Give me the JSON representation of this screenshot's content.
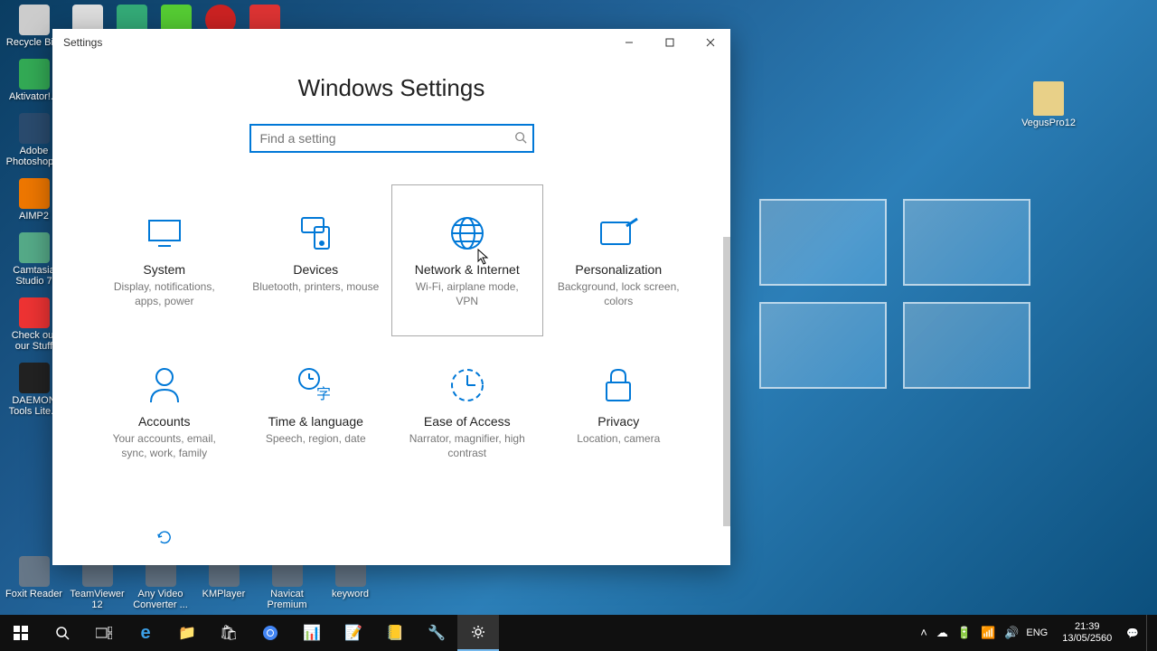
{
  "window": {
    "title": "Settings",
    "page_title": "Windows Settings",
    "search_placeholder": "Find a setting"
  },
  "categories": [
    {
      "name": "System",
      "desc": "Display, notifications, apps, power",
      "hover": false
    },
    {
      "name": "Devices",
      "desc": "Bluetooth, printers, mouse",
      "hover": false
    },
    {
      "name": "Network & Internet",
      "desc": "Wi-Fi, airplane mode, VPN",
      "hover": true
    },
    {
      "name": "Personalization",
      "desc": "Background, lock screen, colors",
      "hover": false
    },
    {
      "name": "Accounts",
      "desc": "Your accounts, email, sync, work, family",
      "hover": false
    },
    {
      "name": "Time & language",
      "desc": "Speech, region, date",
      "hover": false
    },
    {
      "name": "Ease of Access",
      "desc": "Narrator, magnifier, high contrast",
      "hover": false
    },
    {
      "name": "Privacy",
      "desc": "Location, camera",
      "hover": false
    }
  ],
  "desktop_icons_left": [
    "Recycle Bi...",
    "Aktivator!...",
    "Adobe Photoshop...",
    "AIMP2",
    "Camtasia Studio 7",
    "Check out our Stuff",
    "DAEMON Tools Lite..."
  ],
  "desktop_icons_bottom": [
    "Foxit Reader",
    "TeamViewer 12",
    "Any Video Converter ...",
    "KMPlayer",
    "Navicat Premium",
    "keyword"
  ],
  "desktop_icon_right": "VegusPro12",
  "tray": {
    "lang": "ENG",
    "time": "21:39",
    "date": "13/05/2560"
  }
}
